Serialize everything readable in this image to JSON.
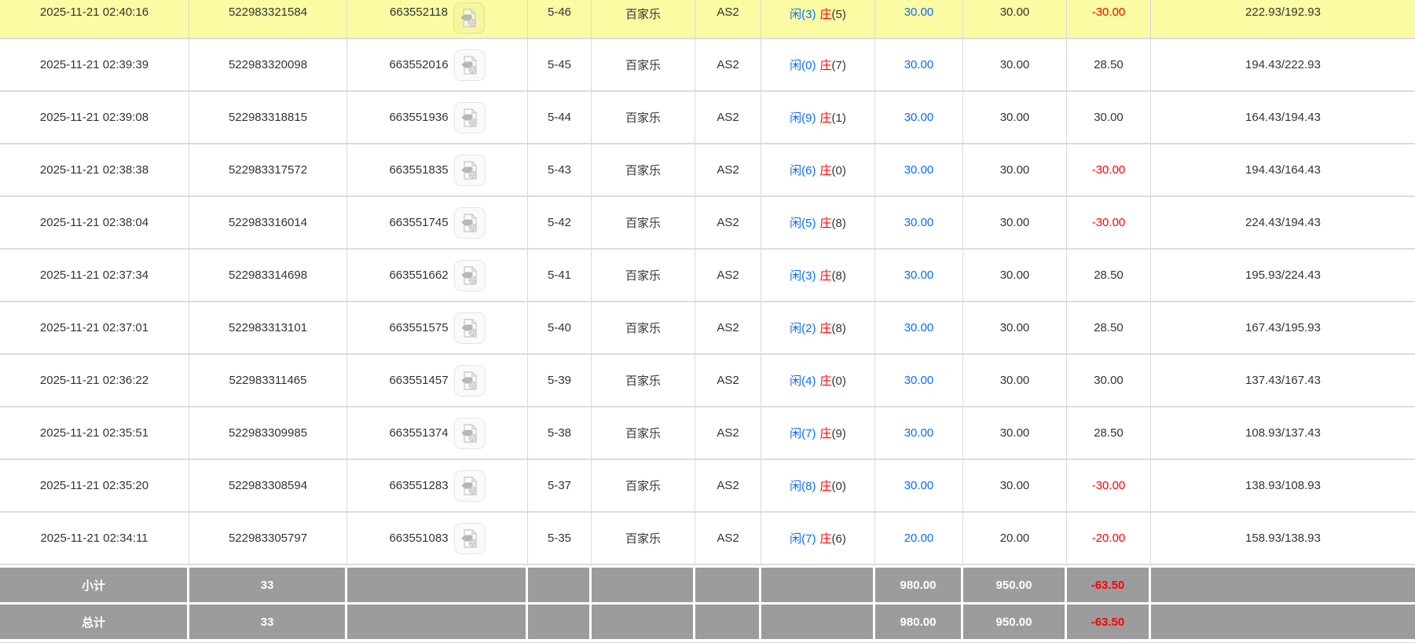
{
  "colors": {
    "highlight_row": "#fbfba4",
    "link_blue": "#0a6cff",
    "banker_red": "#ff0000",
    "loss_red": "#ff0000",
    "body_text": "#333333",
    "footer_bg": "#9c9c9c",
    "footer_text": "#ffffff",
    "grid_line": "#d9d9d9"
  },
  "icons": {
    "video": "video-replay-icon"
  },
  "table": {
    "rows": [
      {
        "time": "2025-11-21 02:40:16",
        "bet_id": "522983321584",
        "round_id": "663552118",
        "round": "5-46",
        "game": "百家乐",
        "table": "AS2",
        "player": "闲(3)",
        "banker": "庄",
        "banker_score": "(5)",
        "bet": "30.00",
        "valid": "30.00",
        "win_loss": "-30.00",
        "balance": "222.93/192.93",
        "highlight": true
      },
      {
        "time": "2025-11-21 02:39:39",
        "bet_id": "522983320098",
        "round_id": "663552016",
        "round": "5-45",
        "game": "百家乐",
        "table": "AS2",
        "player": "闲(0)",
        "banker": "庄",
        "banker_score": "(7)",
        "bet": "30.00",
        "valid": "30.00",
        "win_loss": "28.50",
        "balance": "194.43/222.93",
        "highlight": false
      },
      {
        "time": "2025-11-21 02:39:08",
        "bet_id": "522983318815",
        "round_id": "663551936",
        "round": "5-44",
        "game": "百家乐",
        "table": "AS2",
        "player": "闲(9)",
        "banker": "庄",
        "banker_score": "(1)",
        "bet": "30.00",
        "valid": "30.00",
        "win_loss": "30.00",
        "balance": "164.43/194.43",
        "highlight": false
      },
      {
        "time": "2025-11-21 02:38:38",
        "bet_id": "522983317572",
        "round_id": "663551835",
        "round": "5-43",
        "game": "百家乐",
        "table": "AS2",
        "player": "闲(6)",
        "banker": "庄",
        "banker_score": "(0)",
        "bet": "30.00",
        "valid": "30.00",
        "win_loss": "-30.00",
        "balance": "194.43/164.43",
        "highlight": false
      },
      {
        "time": "2025-11-21 02:38:04",
        "bet_id": "522983316014",
        "round_id": "663551745",
        "round": "5-42",
        "game": "百家乐",
        "table": "AS2",
        "player": "闲(5)",
        "banker": "庄",
        "banker_score": "(8)",
        "bet": "30.00",
        "valid": "30.00",
        "win_loss": "-30.00",
        "balance": "224.43/194.43",
        "highlight": false
      },
      {
        "time": "2025-11-21 02:37:34",
        "bet_id": "522983314698",
        "round_id": "663551662",
        "round": "5-41",
        "game": "百家乐",
        "table": "AS2",
        "player": "闲(3)",
        "banker": "庄",
        "banker_score": "(8)",
        "bet": "30.00",
        "valid": "30.00",
        "win_loss": "28.50",
        "balance": "195.93/224.43",
        "highlight": false
      },
      {
        "time": "2025-11-21 02:37:01",
        "bet_id": "522983313101",
        "round_id": "663551575",
        "round": "5-40",
        "game": "百家乐",
        "table": "AS2",
        "player": "闲(2)",
        "banker": "庄",
        "banker_score": "(8)",
        "bet": "30.00",
        "valid": "30.00",
        "win_loss": "28.50",
        "balance": "167.43/195.93",
        "highlight": false
      },
      {
        "time": "2025-11-21 02:36:22",
        "bet_id": "522983311465",
        "round_id": "663551457",
        "round": "5-39",
        "game": "百家乐",
        "table": "AS2",
        "player": "闲(4)",
        "banker": "庄",
        "banker_score": "(0)",
        "bet": "30.00",
        "valid": "30.00",
        "win_loss": "30.00",
        "balance": "137.43/167.43",
        "highlight": false
      },
      {
        "time": "2025-11-21 02:35:51",
        "bet_id": "522983309985",
        "round_id": "663551374",
        "round": "5-38",
        "game": "百家乐",
        "table": "AS2",
        "player": "闲(7)",
        "banker": "庄",
        "banker_score": "(9)",
        "bet": "30.00",
        "valid": "30.00",
        "win_loss": "28.50",
        "balance": "108.93/137.43",
        "highlight": false
      },
      {
        "time": "2025-11-21 02:35:20",
        "bet_id": "522983308594",
        "round_id": "663551283",
        "round": "5-37",
        "game": "百家乐",
        "table": "AS2",
        "player": "闲(8)",
        "banker": "庄",
        "banker_score": "(0)",
        "bet": "30.00",
        "valid": "30.00",
        "win_loss": "-30.00",
        "balance": "138.93/108.93",
        "highlight": false
      },
      {
        "time": "2025-11-21 02:34:11",
        "bet_id": "522983305797",
        "round_id": "663551083",
        "round": "5-35",
        "game": "百家乐",
        "table": "AS2",
        "player": "闲(7)",
        "banker": "庄",
        "banker_score": "(6)",
        "bet": "20.00",
        "valid": "20.00",
        "win_loss": "-20.00",
        "balance": "158.93/138.93",
        "highlight": false
      }
    ],
    "footer": [
      {
        "label": "小计",
        "count": "33",
        "bet_total": "980.00",
        "valid_total": "950.00",
        "win_loss_total": "-63.50"
      },
      {
        "label": "总计",
        "count": "33",
        "bet_total": "980.00",
        "valid_total": "950.00",
        "win_loss_total": "-63.50"
      }
    ]
  }
}
